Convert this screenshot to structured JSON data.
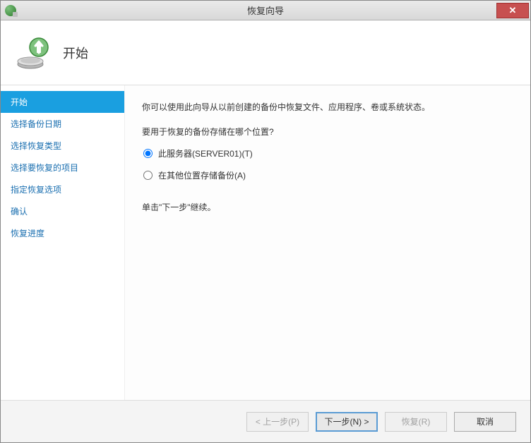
{
  "window": {
    "title": "恢复向导"
  },
  "header": {
    "title": "开始"
  },
  "sidebar": {
    "items": [
      {
        "label": "开始",
        "active": true
      },
      {
        "label": "选择备份日期",
        "active": false
      },
      {
        "label": "选择恢复类型",
        "active": false
      },
      {
        "label": "选择要恢复的项目",
        "active": false
      },
      {
        "label": "指定恢复选项",
        "active": false
      },
      {
        "label": "确认",
        "active": false
      },
      {
        "label": "恢复进度",
        "active": false
      }
    ]
  },
  "content": {
    "description": "你可以使用此向导从以前创建的备份中恢复文件、应用程序、卷或系统状态。",
    "question": "要用于恢复的备份存储在哪个位置?",
    "options": [
      {
        "label": "此服务器(SERVER01)(T)",
        "checked": true
      },
      {
        "label": "在其他位置存储备份(A)",
        "checked": false
      }
    ],
    "hint": "单击\"下一步\"继续。"
  },
  "footer": {
    "prev": "< 上一步(P)",
    "next": "下一步(N) >",
    "recover": "恢复(R)",
    "cancel": "取消"
  }
}
